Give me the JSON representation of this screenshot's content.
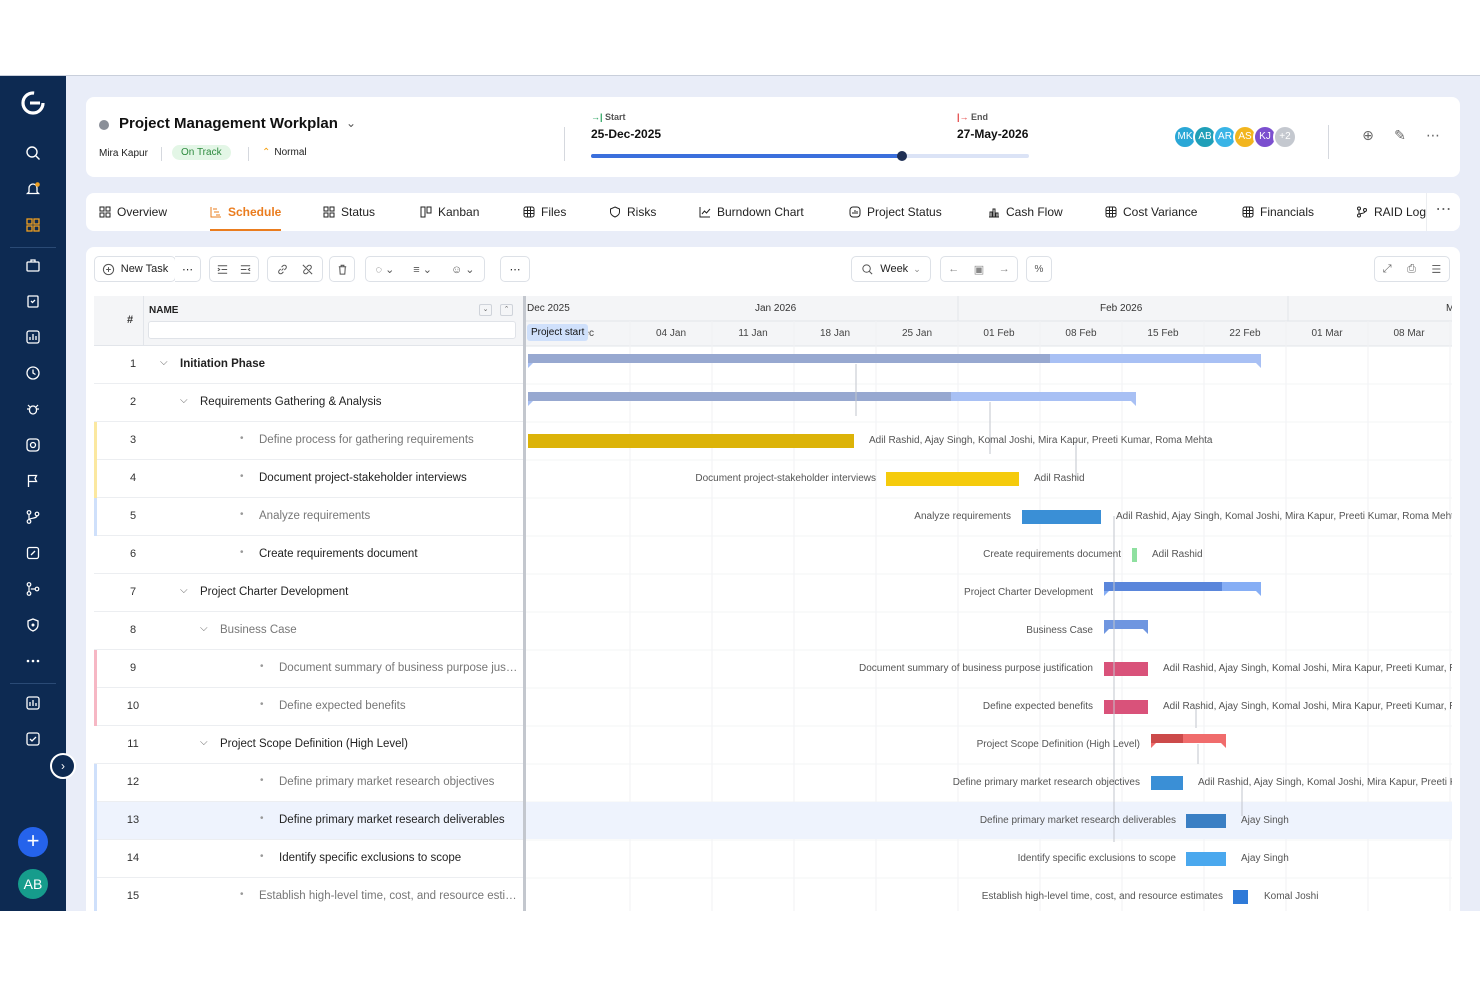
{
  "colors": {
    "sidebar": "#0d2a52",
    "accent": "#ea7c1e",
    "ontrack": "#2d8a3e",
    "progress": "#3b6fdc"
  },
  "project": {
    "title": "Project Management Workplan",
    "owner": "Mira Kapur",
    "status": "On Track",
    "priority": "Normal",
    "start_label": "Start",
    "start_date": "25-Dec-2025",
    "end_label": "End",
    "end_date": "27-May-2026",
    "progress_fraction": 0.71
  },
  "team": [
    {
      "initials": "MK",
      "color": "#2aa7d6"
    },
    {
      "initials": "AB",
      "color": "#1f9fb8"
    },
    {
      "initials": "AR",
      "color": "#39b4e6"
    },
    {
      "initials": "AS",
      "color": "#f2b51e"
    },
    {
      "initials": "KJ",
      "color": "#7b4fcf"
    },
    {
      "initials": "+2",
      "color": "#c4c8cf"
    }
  ],
  "tabs": [
    "Overview",
    "Schedule",
    "Status",
    "Kanban",
    "Files",
    "Risks",
    "Burndown Chart",
    "Project Status",
    "Cash Flow",
    "Cost Variance",
    "Financials",
    "RAID Log"
  ],
  "active_tab": "Schedule",
  "toolbar": {
    "new_task": "New Task",
    "zoom": "Week"
  },
  "grid": {
    "num_header": "#",
    "name_header": "NAME"
  },
  "gantt_header": {
    "months": [
      "Dec 2025",
      "Jan 2026",
      "Feb 2026",
      "M"
    ],
    "weeks": [
      "Dec",
      "04 Jan",
      "11 Jan",
      "18 Jan",
      "25 Jan",
      "01 Feb",
      "08 Feb",
      "15 Feb",
      "22 Feb",
      "01 Mar",
      "08 Mar"
    ],
    "project_start": "Project start"
  },
  "tasks": [
    {
      "num": "1",
      "name": "Initiation Phase",
      "level": 0,
      "parent": true,
      "bold": true
    },
    {
      "num": "2",
      "name": "Requirements Gathering & Analysis",
      "level": 1,
      "parent": true
    },
    {
      "num": "3",
      "name": "Define process for gathering requirements",
      "level": 2,
      "muted": true,
      "res": "Adil Rashid, Ajay Singh, Komal Joshi, Mira Kapur, Preeti Kumar, Roma Mehta"
    },
    {
      "num": "4",
      "name": "Document project-stakeholder interviews",
      "level": 2,
      "res": "Adil Rashid"
    },
    {
      "num": "5",
      "name": "Analyze requirements",
      "level": 2,
      "muted": true,
      "res": "Adil Rashid, Ajay Singh, Komal Joshi, Mira Kapur, Preeti Kumar, Roma Mehta"
    },
    {
      "num": "6",
      "name": "Create requirements document",
      "level": 2,
      "res": "Adil Rashid"
    },
    {
      "num": "7",
      "name": "Project Charter Development",
      "level": 1,
      "parent": true
    },
    {
      "num": "8",
      "name": "Business Case",
      "level": 2,
      "parent": true,
      "muted": true
    },
    {
      "num": "9",
      "name": "Document summary of business purpose justification",
      "display": "Document summary of business purpose justifica...",
      "level": 3,
      "muted": true,
      "res": "Adil Rashid, Ajay Singh, Komal Joshi, Mira Kapur, Preeti Kumar, R"
    },
    {
      "num": "10",
      "name": "Define expected benefits",
      "level": 3,
      "muted": true,
      "res": "Adil Rashid, Ajay Singh, Komal Joshi, Mira Kapur, Preeti Kumar, R"
    },
    {
      "num": "11",
      "name": "Project Scope Definition (High Level)",
      "level": 2,
      "parent": true
    },
    {
      "num": "12",
      "name": "Define primary market research objectives",
      "level": 3,
      "muted": true,
      "res": "Adil Rashid, Ajay Singh, Komal Joshi, Mira Kapur, Preeti K"
    },
    {
      "num": "13",
      "name": "Define primary market research deliverables",
      "level": 3,
      "selected": true,
      "res": "Ajay Singh"
    },
    {
      "num": "14",
      "name": "Identify specific exclusions to scope",
      "level": 3,
      "res": "Ajay Singh"
    },
    {
      "num": "15",
      "name": "Establish high-level time, cost, and resource estimates",
      "level": 2,
      "muted": true,
      "res": "Komal Joshi"
    }
  ]
}
